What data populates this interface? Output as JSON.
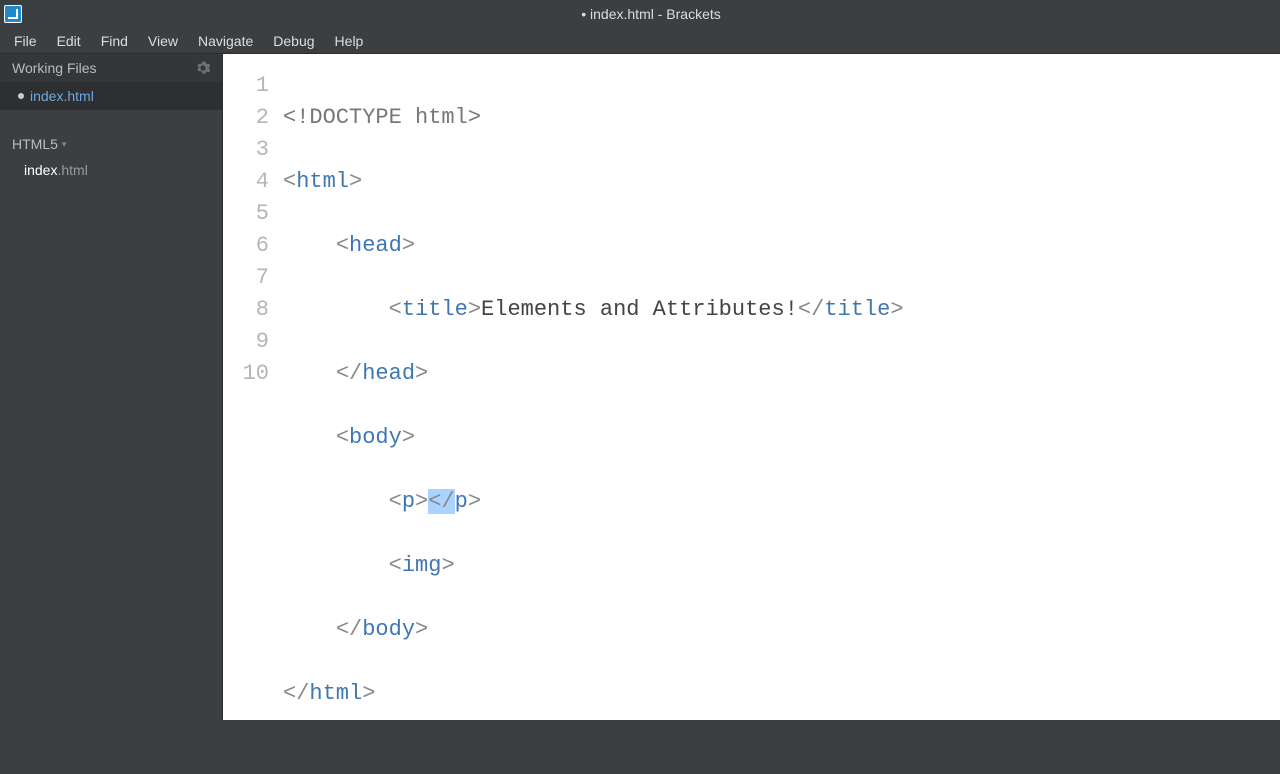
{
  "titlebar": {
    "dirty_marker": "•",
    "filename": "index.html",
    "separator": " - ",
    "appname": "Brackets"
  },
  "menu": {
    "file": "File",
    "edit": "Edit",
    "find": "Find",
    "view": "View",
    "navigate": "Navigate",
    "debug": "Debug",
    "help": "Help"
  },
  "sidebar": {
    "working_files_label": "Working Files",
    "working_file_name": "index.html",
    "project_name": "HTML5",
    "file_basename": "index",
    "file_ext": ".html"
  },
  "code": {
    "line_numbers": [
      "1",
      "2",
      "3",
      "4",
      "5",
      "6",
      "7",
      "8",
      "9",
      "10"
    ],
    "l1_a": "<!DOCTYPE html>",
    "l2_a": "<",
    "l2_b": "html",
    "l2_c": ">",
    "l3_a": "<",
    "l3_b": "head",
    "l3_c": ">",
    "l4_a": "<",
    "l4_b": "title",
    "l4_c": ">",
    "l4_d": "Elements and Attributes!",
    "l4_e": "</",
    "l4_f": "title",
    "l4_g": ">",
    "l5_a": "</",
    "l5_b": "head",
    "l5_c": ">",
    "l6_a": "<",
    "l6_b": "body",
    "l6_c": ">",
    "l7_a": "<",
    "l7_b": "p",
    "l7_c": ">",
    "l7_d": "<",
    "l7_e": "/",
    "l7_f": "p",
    "l7_g": ">",
    "l8_a": "<",
    "l8_b": "img",
    "l8_c": ">",
    "l9_a": "</",
    "l9_b": "body",
    "l9_c": ">",
    "l10_a": "</",
    "l10_b": "html",
    "l10_c": ">"
  }
}
